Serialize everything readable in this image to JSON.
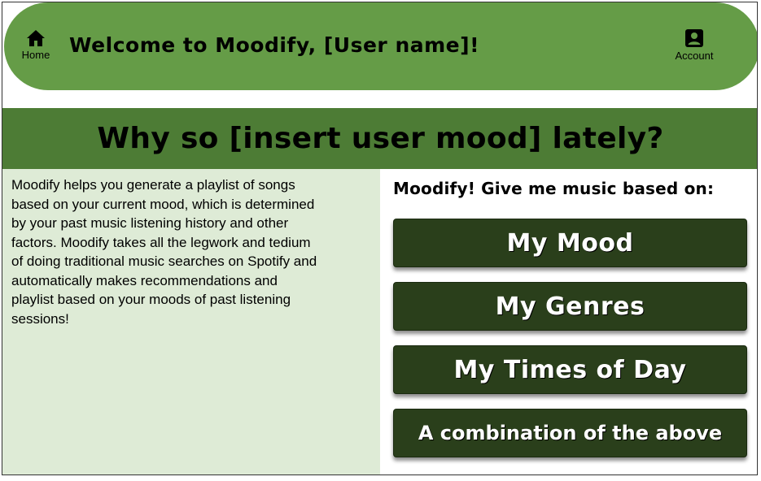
{
  "header": {
    "home_label": "Home",
    "home_icon": "home-icon",
    "welcome_text": "Welcome to Moodify, [User name]!",
    "account_label": "Account",
    "account_icon": "account-icon",
    "bar_color": "#659c47"
  },
  "banner": {
    "title": "Why so [insert user mood] lately?",
    "color": "#4d7c35"
  },
  "description": {
    "text": "Moodify helps you generate a playlist of songs based on your current mood, which is determined by your past music listening history and other factors. Moodify takes all the legwork and tedium of doing traditional music searches on Spotify and automatically makes recommendations and playlist based on your moods of past listening sessions!",
    "background": "#deebd6"
  },
  "options": {
    "heading": "Moodify! Give me music based on:",
    "buttons": [
      {
        "label": "My Mood"
      },
      {
        "label": "My Genres"
      },
      {
        "label": "My Times of Day"
      },
      {
        "label": "A combination of the above"
      }
    ],
    "button_color": "#2a3f1b"
  }
}
